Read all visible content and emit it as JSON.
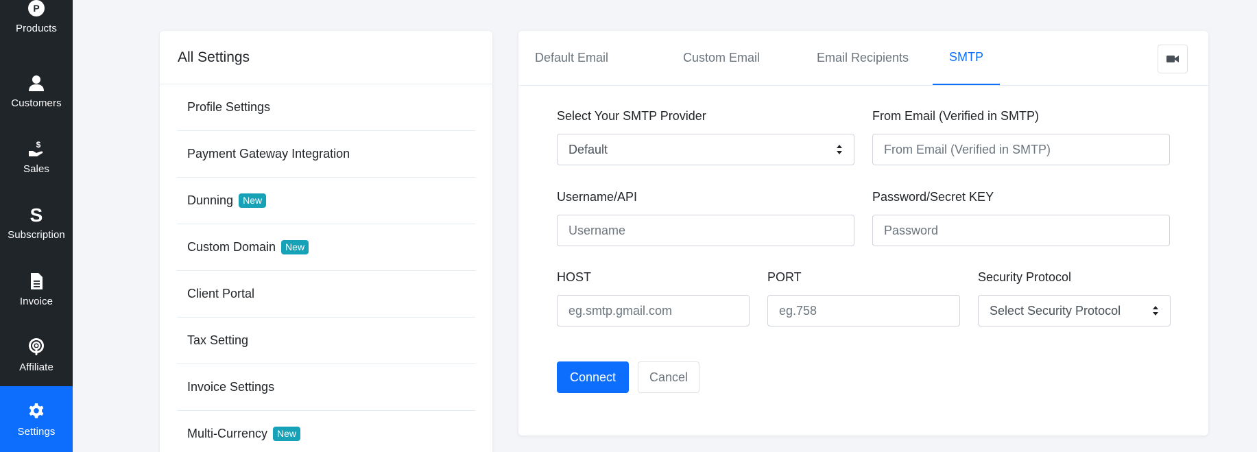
{
  "sidebar": {
    "items": [
      {
        "label": "Products",
        "icon": "products-icon"
      },
      {
        "label": "Customers",
        "icon": "user-icon"
      },
      {
        "label": "Sales",
        "icon": "hand-dollar-icon"
      },
      {
        "label": "Subscription",
        "icon": "subscription-s-icon"
      },
      {
        "label": "Invoice",
        "icon": "document-icon"
      },
      {
        "label": "Affiliate",
        "icon": "podcast-icon"
      },
      {
        "label": "Settings",
        "icon": "gear-icon",
        "active": true
      }
    ],
    "background": "#20252a",
    "active_color": "#0d6efd"
  },
  "settings_panel": {
    "title": "All Settings",
    "items": [
      {
        "label": "Profile Settings",
        "badge": ""
      },
      {
        "label": "Payment Gateway Integration",
        "badge": ""
      },
      {
        "label": "Dunning",
        "badge": "New"
      },
      {
        "label": "Custom Domain",
        "badge": "New"
      },
      {
        "label": "Client Portal",
        "badge": ""
      },
      {
        "label": "Tax Setting",
        "badge": ""
      },
      {
        "label": "Invoice Settings",
        "badge": ""
      },
      {
        "label": "Multi-Currency",
        "badge": "New"
      }
    ]
  },
  "smtp_panel": {
    "tabs": [
      {
        "label": "Default Email"
      },
      {
        "label": "Custom Email"
      },
      {
        "label": "Email Recipients"
      },
      {
        "label": "SMTP",
        "active": true
      }
    ],
    "video_button_icon": "video-camera-icon",
    "form": {
      "provider_label": "Select Your SMTP Provider",
      "provider_value": "Default",
      "from_email_label": "From Email (Verified in SMTP)",
      "from_email_placeholder": "From Email (Verified in SMTP)",
      "username_label": "Username/API",
      "username_placeholder": "Username",
      "password_label": "Password/Secret KEY",
      "password_placeholder": "Password",
      "host_label": "HOST",
      "host_placeholder": "eg.smtp.gmail.com",
      "port_label": "PORT",
      "port_placeholder": "eg.758",
      "security_label": "Security Protocol",
      "security_value": "Select Security Protocol"
    },
    "buttons": {
      "connect": "Connect",
      "cancel": "Cancel"
    }
  },
  "colors": {
    "primary": "#0d6efd",
    "badge": "#17a2b8",
    "page_background": "#f3f5f8"
  }
}
